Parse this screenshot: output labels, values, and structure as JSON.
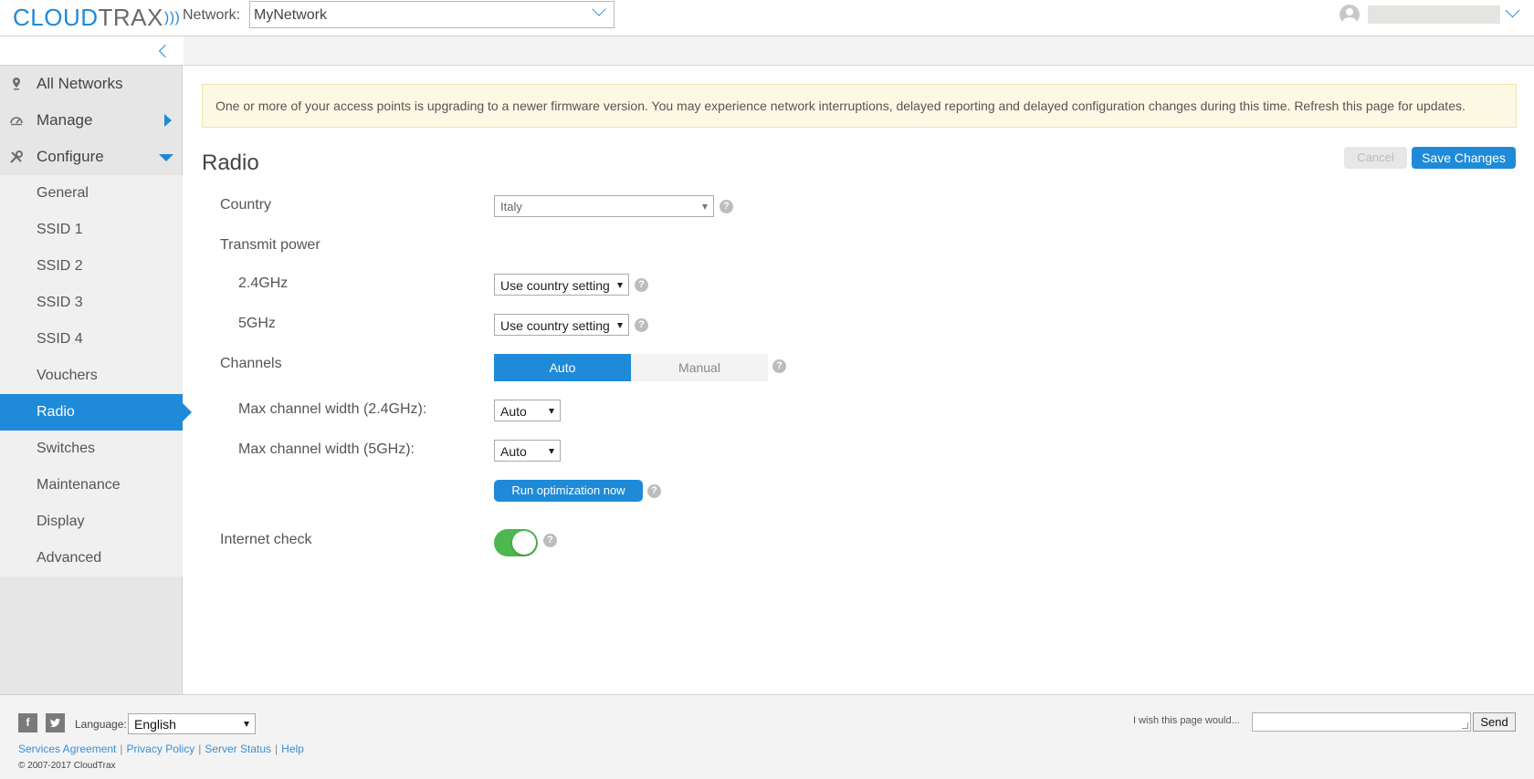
{
  "header": {
    "logo_cloud": "CLOUD",
    "logo_trax": "TRAX",
    "network_label": "Network:",
    "network_value": "MyNetwork"
  },
  "sidebar": {
    "top_items": [
      {
        "label": "All Networks",
        "icon": "map-pin-icon"
      },
      {
        "label": "Manage",
        "icon": "dashboard-icon"
      },
      {
        "label": "Configure",
        "icon": "wrench-icon"
      }
    ],
    "sub_items": [
      {
        "label": "General"
      },
      {
        "label": "SSID 1"
      },
      {
        "label": "SSID 2"
      },
      {
        "label": "SSID 3"
      },
      {
        "label": "SSID 4"
      },
      {
        "label": "Vouchers"
      },
      {
        "label": "Radio",
        "active": true
      },
      {
        "label": "Switches"
      },
      {
        "label": "Maintenance"
      },
      {
        "label": "Display"
      },
      {
        "label": "Advanced"
      }
    ]
  },
  "banner": {
    "text": "One or more of your access points is upgrading to a newer firmware version. You may experience network interruptions, delayed reporting and delayed configuration changes during this time. Refresh this page for updates."
  },
  "page": {
    "title": "Radio",
    "cancel_label": "Cancel",
    "save_label": "Save Changes"
  },
  "form": {
    "country_label": "Country",
    "country_value": "Italy",
    "transmit_power_label": "Transmit power",
    "band24_label": "2.4GHz",
    "band24_value": "Use country setting",
    "band5_label": "5GHz",
    "band5_value": "Use country setting",
    "channels_label": "Channels",
    "channels_auto": "Auto",
    "channels_manual": "Manual",
    "maxwidth24_label": "Max channel width (2.4GHz):",
    "maxwidth24_value": "Auto",
    "maxwidth5_label": "Max channel width (5GHz):",
    "maxwidth5_value": "Auto",
    "run_optimization_label": "Run optimization now",
    "internet_check_label": "Internet check",
    "internet_check_on": true,
    "help_glyph": "?"
  },
  "footer": {
    "facebook": "f",
    "twitter": "t",
    "language_label": "Language:",
    "language_value": "English",
    "links": [
      "Services Agreement",
      "Privacy Policy",
      "Server Status",
      "Help"
    ],
    "separator": "|",
    "copyright": "© 2007-2017 CloudTrax",
    "wish_label": "I wish this page would...",
    "send_label": "Send"
  },
  "colors": {
    "accent": "#1f8ad8",
    "toggle_on": "#4cb84f",
    "banner_bg": "#fcf8e3"
  }
}
